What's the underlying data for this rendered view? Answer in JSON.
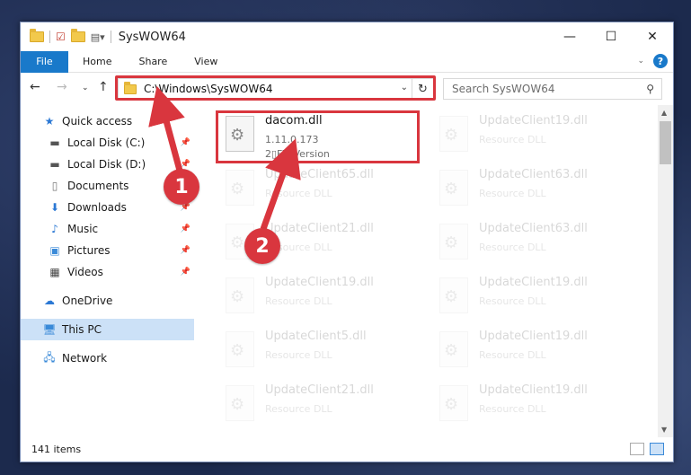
{
  "window": {
    "title": "SysWOW64"
  },
  "ribbon": {
    "file": "File",
    "tabs": [
      "Home",
      "Share",
      "View"
    ]
  },
  "address": {
    "path": "C:\\Windows\\SysWOW64"
  },
  "search": {
    "placeholder": "Search SysWOW64"
  },
  "sidebar": {
    "items": [
      {
        "label": "Quick access",
        "icon": "star-icon"
      },
      {
        "label": "Local Disk (C:)",
        "icon": "drive-icon"
      },
      {
        "label": "Local Disk (D:)",
        "icon": "drive-icon"
      },
      {
        "label": "Documents",
        "icon": "documents-icon"
      },
      {
        "label": "Downloads",
        "icon": "download-icon"
      },
      {
        "label": "Music",
        "icon": "music-icon"
      },
      {
        "label": "Pictures",
        "icon": "pictures-icon"
      },
      {
        "label": "Videos",
        "icon": "videos-icon"
      },
      {
        "label": "OneDrive",
        "icon": "cloud-icon"
      },
      {
        "label": "This PC",
        "icon": "computer-icon"
      },
      {
        "label": "Network",
        "icon": "network-icon"
      }
    ]
  },
  "files": {
    "highlighted": {
      "name": "dacom.dll",
      "line1": "1.11.0.173",
      "line2": "2\u0000FileVersion"
    },
    "faded": [
      {
        "name": "UpdateClient19.dll",
        "type": "Resource DLL"
      },
      {
        "name": "UpdateClient65.dll",
        "type": "Resource DLL"
      },
      {
        "name": "UpdateClient63.dll",
        "type": "Resource DLL"
      },
      {
        "name": "UpdateClient21.dll",
        "type": "Resource DLL"
      },
      {
        "name": "UpdateClient63.dll",
        "type": "Resource DLL"
      },
      {
        "name": "UpdateClient19.dll",
        "type": "Resource DLL"
      },
      {
        "name": "UpdateClient19.dll",
        "type": "Resource DLL"
      },
      {
        "name": "UpdateClient5.dll",
        "type": "Resource DLL"
      },
      {
        "name": "UpdateClient19.dll",
        "type": "Resource DLL"
      },
      {
        "name": "UpdateClient21.dll",
        "type": "Resource DLL"
      },
      {
        "name": "UpdateClient19.dll",
        "type": "Resource DLL"
      }
    ]
  },
  "status": {
    "count": "141 items"
  },
  "annotations": {
    "badge1": "1",
    "badge2": "2",
    "color": "#d9363e"
  }
}
